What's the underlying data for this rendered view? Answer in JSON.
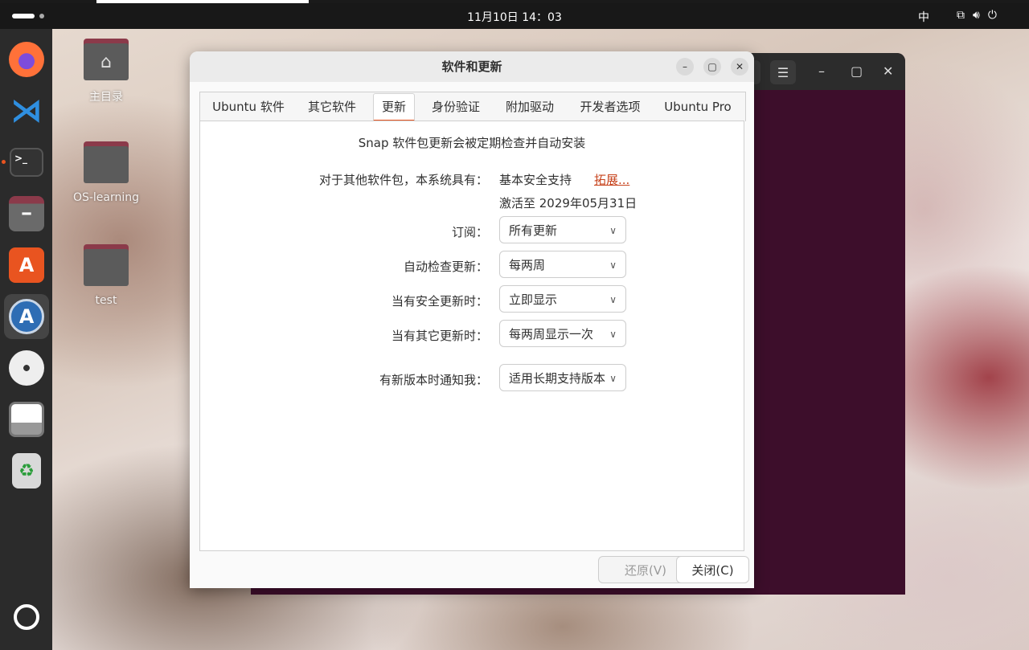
{
  "topbar": {
    "clock": "11月10日  14：03",
    "ime": "中",
    "tray_icons": [
      "network-icon",
      "volume-icon",
      "power-icon"
    ]
  },
  "dock": {
    "items": [
      {
        "name": "firefox",
        "icon": "firefox-icon"
      },
      {
        "name": "vscode",
        "icon": "vscode-icon"
      },
      {
        "name": "terminal",
        "icon": "terminal-icon",
        "running": true
      },
      {
        "name": "files",
        "icon": "files-icon"
      },
      {
        "name": "app-center",
        "icon": "app-center-icon"
      },
      {
        "name": "software-updater",
        "icon": "software-updater-icon",
        "active": true
      },
      {
        "name": "disc",
        "icon": "disc-icon"
      },
      {
        "name": "save",
        "icon": "floppy-icon"
      },
      {
        "name": "trash",
        "icon": "trash-icon"
      },
      {
        "name": "show-apps",
        "icon": "ubuntu-logo-icon"
      }
    ]
  },
  "desktop": {
    "icons": [
      {
        "label": "主目录"
      },
      {
        "label": "OS-learning"
      },
      {
        "label": "test"
      }
    ]
  },
  "dialog": {
    "title": "软件和更新",
    "tabs": [
      {
        "label": "Ubuntu 软件"
      },
      {
        "label": "其它软件"
      },
      {
        "label": "更新",
        "active": true
      },
      {
        "label": "身份验证"
      },
      {
        "label": "附加驱动"
      },
      {
        "label": "开发者选项"
      },
      {
        "label": "Ubuntu Pro"
      }
    ],
    "snap_note": "Snap 软件包更新会被定期检查并自动安装",
    "other_packages_label": "对于其他软件包，本系统具有：",
    "support_value": "基本安全支持",
    "extend_link": "拓展...",
    "activated_until": "激活至 2029年05月31日",
    "rows": [
      {
        "label": "订阅：",
        "value": "所有更新"
      },
      {
        "label": "自动检查更新：",
        "value": "每两周"
      },
      {
        "label": "当有安全更新时：",
        "value": "立即显示"
      },
      {
        "label": "当有其它更新时：",
        "value": "每两周显示一次"
      },
      {
        "label": "有新版本时通知我：",
        "value": "适用长期支持版本"
      }
    ],
    "revert_button": "还原(V)",
    "close_button": "关闭(C)"
  },
  "colors": {
    "accent": "#e95420",
    "terminal_bg": "#3d0e2b",
    "link": "#c7441e"
  }
}
